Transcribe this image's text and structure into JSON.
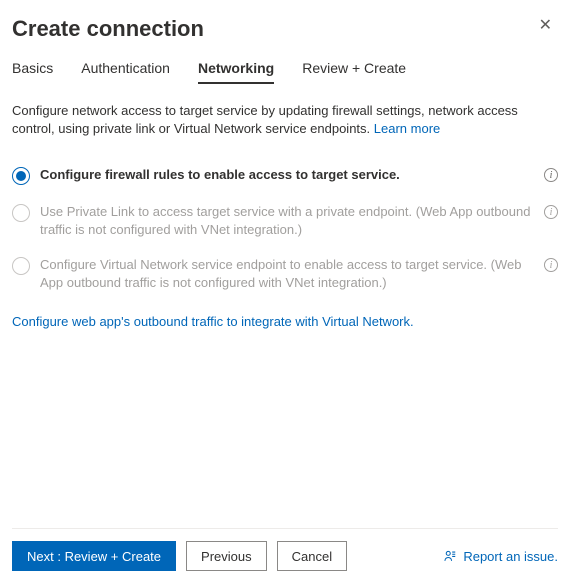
{
  "header": {
    "title": "Create connection",
    "close_glyph": "✕"
  },
  "tabs": {
    "items": [
      {
        "label": "Basics",
        "active": false
      },
      {
        "label": "Authentication",
        "active": false
      },
      {
        "label": "Networking",
        "active": true
      },
      {
        "label": "Review + Create",
        "active": false
      }
    ]
  },
  "description": {
    "text": "Configure network access to target service by updating firewall settings, network access control, using private link or Virtual Network service endpoints.",
    "learn_more": "Learn more"
  },
  "options": [
    {
      "label": "Configure firewall rules to enable access to target service.",
      "state": "selected",
      "info": true
    },
    {
      "label": "Use Private Link to access target service with a private endpoint. (Web App outbound traffic is not configured with VNet integration.)",
      "state": "disabled",
      "info": true
    },
    {
      "label": "Configure Virtual Network service endpoint to enable access to target service. (Web App outbound traffic is not configured with VNet integration.)",
      "state": "disabled",
      "info": true
    }
  ],
  "vnet_link": "Configure web app's outbound traffic to integrate with Virtual Network.",
  "footer": {
    "next": "Next : Review + Create",
    "previous": "Previous",
    "cancel": "Cancel",
    "report": "Report an issue."
  },
  "info_glyph": "i"
}
